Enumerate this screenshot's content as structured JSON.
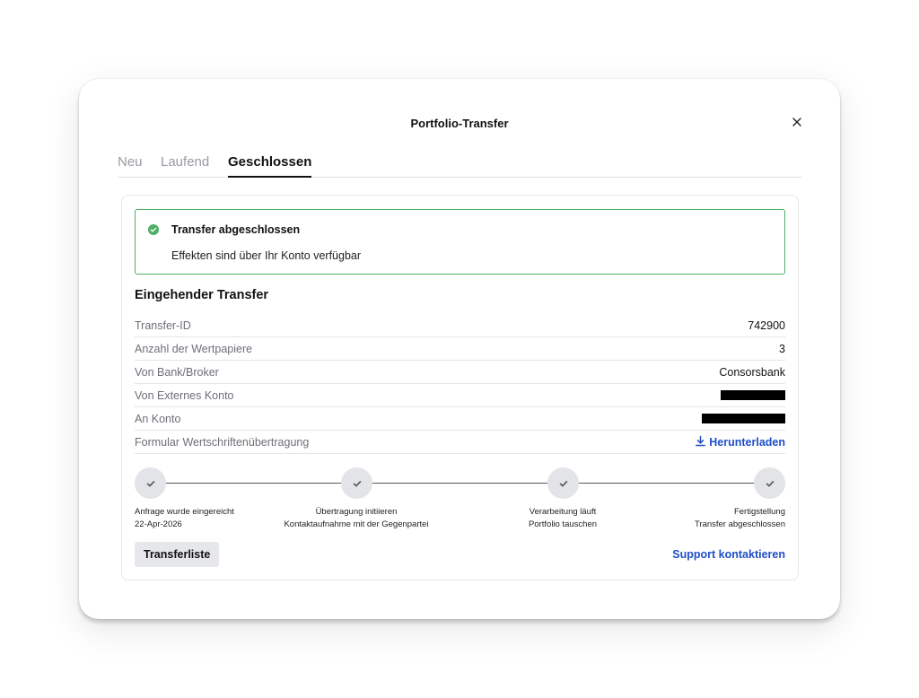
{
  "modal": {
    "title": "Portfolio-Transfer"
  },
  "tabs": [
    {
      "label": "Neu"
    },
    {
      "label": "Laufend"
    },
    {
      "label": "Geschlossen"
    }
  ],
  "alert": {
    "title": "Transfer abgeschlossen",
    "text": "Effekten sind über Ihr Konto verfügbar",
    "color": "#4caf64"
  },
  "details": {
    "title": "Eingehender Transfer",
    "rows": [
      {
        "label": "Transfer-ID",
        "value": "742900"
      },
      {
        "label": "Anzahl der Wertpapiere",
        "value": "3"
      },
      {
        "label": "Von Bank/Broker",
        "value": "Consorsbank"
      },
      {
        "label": "Von Externes Konto",
        "value": ""
      },
      {
        "label": "An Konto",
        "value": ""
      },
      {
        "label": "Formular Wertschriftenübertragung",
        "link": "Herunterladen"
      }
    ]
  },
  "steps": [
    {
      "line1": "Anfrage wurde eingereicht",
      "line2": "22-Apr-2026"
    },
    {
      "line1": "Übertragung initiieren",
      "line2": "Kontaktaufnahme mit der Gegenpartei"
    },
    {
      "line1": "Verarbeitung läuft",
      "line2": "Portfolio tauschen"
    },
    {
      "line1": "Fertigstellung",
      "line2": "Transfer abgeschlossen"
    }
  ],
  "actions": {
    "list_button": "Transferliste",
    "support_link": "Support kontaktieren"
  },
  "colors": {
    "link": "#1f4fc7",
    "success": "#4caf64"
  }
}
